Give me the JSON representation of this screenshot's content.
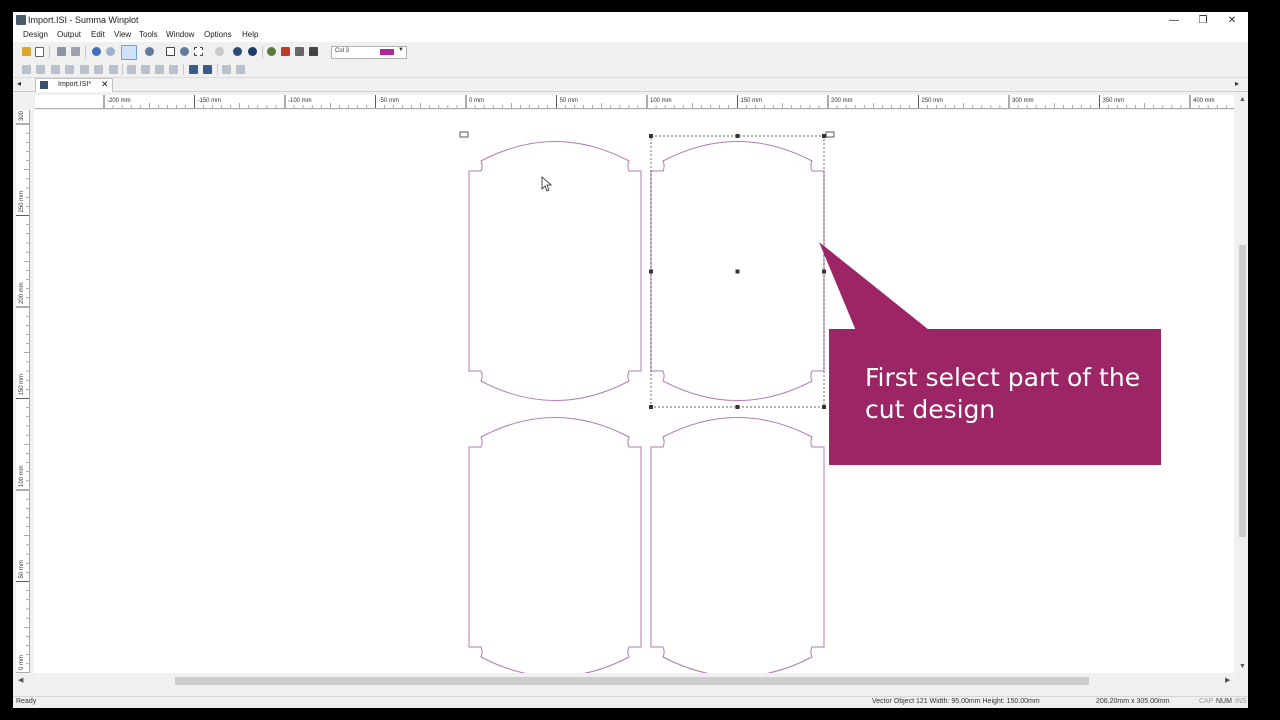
{
  "window": {
    "title": "Import.ISI - Summa Winplot",
    "minimize": "—",
    "maximize": "❐",
    "close": "✕"
  },
  "menu": [
    "Design",
    "Output",
    "Edit",
    "View",
    "Tools",
    "Window",
    "Options",
    "Help"
  ],
  "toolbar": {
    "color_label": "Col 3",
    "color_value": "#b0289c"
  },
  "tab": {
    "label": "Import.ISI*",
    "close": "✕"
  },
  "ruler_top": [
    "-200 mm",
    "-150 mm",
    "-100 mm",
    "-50 mm",
    "0 mm",
    "50 mm",
    "100 mm",
    "150 mm",
    "200 mm",
    "250 mm",
    "300 mm",
    "350 mm",
    "400 mm"
  ],
  "ruler_left": [
    "300 mm",
    "250 mm",
    "200 mm",
    "150 mm",
    "100 mm",
    "50 mm",
    "0 mm"
  ],
  "callout": {
    "text": "First select part of the cut design"
  },
  "status": {
    "left": "Ready",
    "object": "Vector Object 121  Width: 95.00mm Height: 150.00mm",
    "size": "206.20mm x 305.00mm",
    "caps": "CAP",
    "num": "NUM",
    "ins": "INS"
  },
  "colors": {
    "accent": "#9c2566",
    "outline": "#b47ab4"
  }
}
